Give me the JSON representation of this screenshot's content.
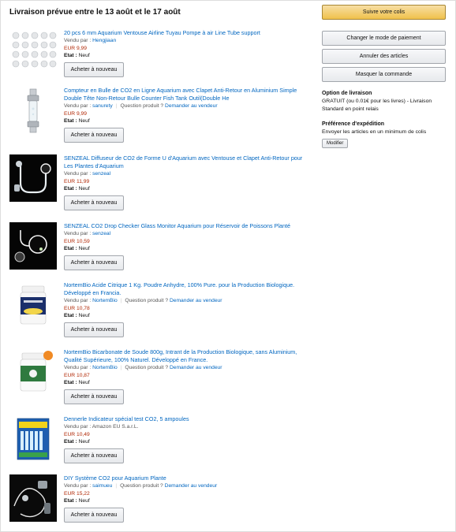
{
  "heading": "Livraison prévue entre le 13 août et le 17 août",
  "labels": {
    "sold_by": "Vendu par :",
    "question": "Question produit ?",
    "ask_seller": "Demander au vendeur",
    "state": "Etat :",
    "rebuy": "Acheter à nouveau"
  },
  "items": [
    {
      "title": "20 pcs 6 mm Aquarium Ventouse Airline Tuyau Pompe à air Line Tube support",
      "seller": "Hengjiaan",
      "has_question": false,
      "price": "EUR 9,99",
      "state": "Neuf",
      "image": "suction-cups"
    },
    {
      "title": "Compteur en Bulle de CO2 en Ligne Aquarium avec Clapet Anti-Retour en Aluminium Simple Double Tête Non-Retour Bulle Counter Fish Tank Outil(Double He",
      "seller": "sanurety",
      "has_question": true,
      "price": "EUR 9,99",
      "state": "Neuf",
      "image": "bubble-counter"
    },
    {
      "title": "SENZEAL Diffuseur de CO2 de Forme U d'Aquarium avec Ventouse et Clapet Anti-Retour pour Les Plantes d'Aquarium",
      "seller": "senzeal",
      "has_question": false,
      "price": "EUR 11,99",
      "state": "Neuf",
      "image": "u-diffuser"
    },
    {
      "title": "SENZEAL CO2 Drop Checker Glass Monitor Aquarium pour Réservoir de Poissons Planté",
      "seller": "senzeal",
      "has_question": false,
      "price": "EUR 10,59",
      "state": "Neuf",
      "image": "drop-checker"
    },
    {
      "title": "NortemBio Acide Citrique 1 Kg. Poudre Anhydre, 100% Pure. pour la Production Biologique. Développé en Francia.",
      "seller": "NortemBio",
      "has_question": true,
      "price": "EUR 10,78",
      "state": "Neuf",
      "image": "citric-jar"
    },
    {
      "title": "NortemBio Bicarbonate de Soude 800g, Intrant de la Production Biologique, sans Aluminium, Qualité Supérieure, 100% Naturel. Développé en France.",
      "seller": "NortemBio",
      "has_question": true,
      "price": "EUR 10,87",
      "state": "Neuf",
      "image": "bicarbonate-jar"
    },
    {
      "title": "Dennerle Indicateur spécial test CO2, 5 ampoules",
      "seller_plain": "Amazon EU S.a.r.L.",
      "has_question": false,
      "price": "EUR 10,49",
      "state": "Neuf",
      "image": "co2-test-box"
    },
    {
      "title": "DIY Système CO2 pour Aquarium Plante",
      "seller": "saimueu",
      "has_question": true,
      "price": "EUR 15,22",
      "state": "Neuf",
      "image": "co2-system-kit"
    }
  ],
  "sidebar": {
    "track_button": "Suivre votre colis",
    "change_payment": "Changer le mode de paiement",
    "cancel_items": "Annuler des articles",
    "hide_order": "Masquer la commande",
    "delivery_option_title": "Option de livraison",
    "delivery_option_text": "GRATUIT (ou 0.01€ pour les livres) - Livraison Standard en point relais",
    "shipping_pref_title": "Préférence d'expédition",
    "shipping_pref_text": "Envoyer les articles en un minimum de colis",
    "modify_button": "Modifier"
  },
  "colors": {
    "link": "#0066c0",
    "price": "#b12704",
    "primary_button": "#f0c14b"
  }
}
